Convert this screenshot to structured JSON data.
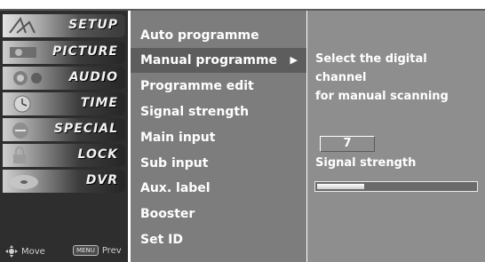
{
  "categories": [
    {
      "label": "SETUP",
      "icon": "setup-thumbnail-icon"
    },
    {
      "label": "PICTURE",
      "icon": "picture-thumbnail-icon"
    },
    {
      "label": "AUDIO",
      "icon": "audio-thumbnail-icon"
    },
    {
      "label": "TIME",
      "icon": "clock-thumbnail-icon"
    },
    {
      "label": "SPECIAL",
      "icon": "special-thumbnail-icon"
    },
    {
      "label": "LOCK",
      "icon": "lock-thumbnail-icon"
    },
    {
      "label": "DVR",
      "icon": "dvr-disc-thumbnail-icon"
    }
  ],
  "selected_category": "SETUP",
  "hints": {
    "move_label": "Move",
    "menu_key": "MENU",
    "prev_label": "Prev"
  },
  "menu": {
    "items": [
      {
        "label": "Auto programme"
      },
      {
        "label": "Manual programme",
        "arrow": "▶"
      },
      {
        "label": "Programme edit"
      },
      {
        "label": "Signal strength"
      },
      {
        "label": "Main input"
      },
      {
        "label": "Sub input"
      },
      {
        "label": "Aux. label"
      },
      {
        "label": "Booster"
      },
      {
        "label": "Set ID"
      }
    ],
    "selected": "Manual programme"
  },
  "panel": {
    "desc_line1": "Select the digital",
    "desc_line2": "channel",
    "desc_line3": "for manual scanning",
    "channel_value": "7",
    "signal_label": "Signal strength",
    "signal_level": 0.3
  },
  "colors": {
    "menu_bg": "#7d7d7d",
    "panel_bg": "#8e8e8e",
    "side_bg": "#2e2e2e"
  }
}
